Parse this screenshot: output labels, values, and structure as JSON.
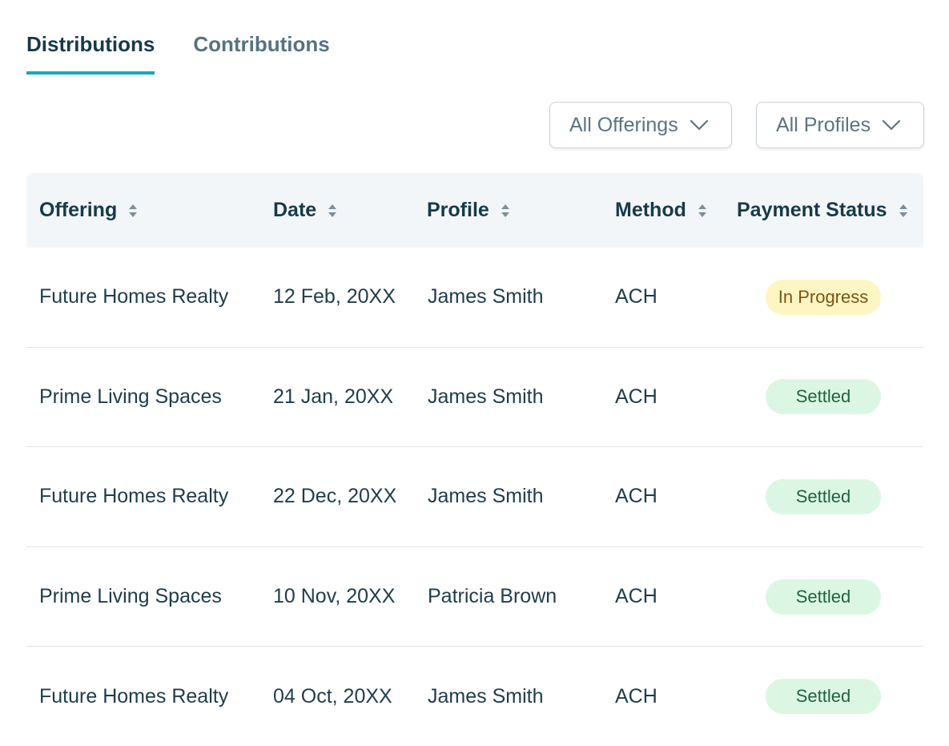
{
  "tabs": [
    {
      "label": "Distributions",
      "active": true
    },
    {
      "label": "Contributions",
      "active": false
    }
  ],
  "filters": {
    "offerings_label": "All Offerings",
    "profiles_label": "All Profiles"
  },
  "table": {
    "headers": [
      "Offering",
      "Date",
      "Profile",
      "Method",
      "Payment Status"
    ],
    "rows": [
      {
        "offering": "Future Homes Realty",
        "date": "12 Feb, 20XX",
        "profile": "James Smith",
        "method": "ACH",
        "status": "In Progress"
      },
      {
        "offering": "Prime Living Spaces",
        "date": "21 Jan, 20XX",
        "profile": "James Smith",
        "method": "ACH",
        "status": "Settled"
      },
      {
        "offering": "Future Homes Realty",
        "date": "22 Dec, 20XX",
        "profile": "James Smith",
        "method": "ACH",
        "status": "Settled"
      },
      {
        "offering": "Prime Living Spaces",
        "date": "10 Nov, 20XX",
        "profile": "Patricia Brown",
        "method": "ACH",
        "status": "Settled"
      },
      {
        "offering": "Future Homes Realty",
        "date": "04 Oct, 20XX",
        "profile": "James Smith",
        "method": "ACH",
        "status": "Settled"
      }
    ]
  },
  "icons": {
    "dropdown": "chevron-down-icon",
    "sort": "sort-icon"
  },
  "colors": {
    "accent": "#1aa8b5",
    "text_primary": "#163a4b",
    "text_muted": "#557280",
    "header_bg": "#f3f6f9",
    "in_progress_bg": "#fdf6c3",
    "in_progress_text": "#7a5415",
    "settled_bg": "#dbf7e3",
    "settled_text": "#226142"
  }
}
